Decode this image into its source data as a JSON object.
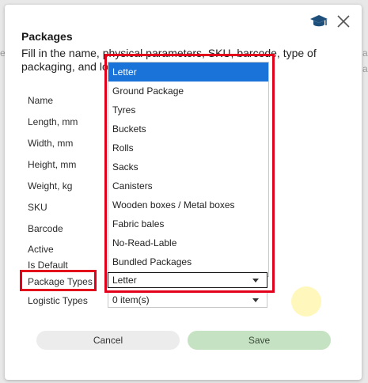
{
  "dialog": {
    "title": "Packages",
    "description": "Fill in the name, physical parameters, SKU, barcode, type of packaging, and lo",
    "close_icon": "close-icon",
    "help_icon": "graduation-cap-icon"
  },
  "form": {
    "labels": {
      "name": "Name",
      "length": "Length, mm",
      "width": "Width, mm",
      "height": "Height, mm",
      "weight": "Weight, kg",
      "sku": "SKU",
      "barcode": "Barcode",
      "active": "Active",
      "is_default": "Is Default",
      "package_types": "Package Types",
      "logistic_types": "Logistic Types"
    },
    "package_types_value": "Letter",
    "logistic_types_value": "0 item(s)"
  },
  "dropdown": {
    "options": [
      "Letter",
      "Ground Package",
      "Tyres",
      "Buckets",
      "Rolls",
      "Sacks",
      "Canisters",
      "Wooden boxes / Metal boxes",
      "Fabric bales",
      "No-Read-Lable",
      "Bundled Packages"
    ],
    "selected": "Letter"
  },
  "buttons": {
    "cancel": "Cancel",
    "save": "Save"
  },
  "colors": {
    "selected_option": "#1a73d9",
    "save_button": "#c5e3c2",
    "highlight": "#e3001b",
    "help_icon": "#1e4f7a"
  }
}
